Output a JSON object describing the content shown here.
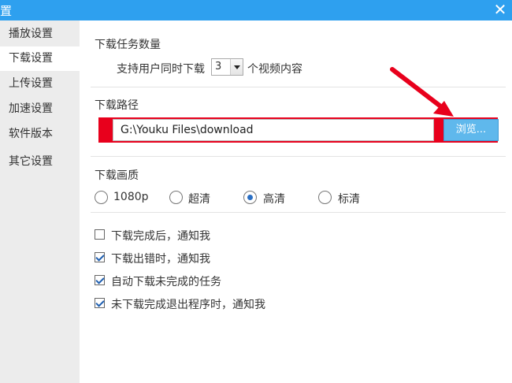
{
  "window": {
    "title": "置",
    "close_symbol": "✕"
  },
  "sidebar": {
    "items": [
      {
        "label": "播放设置",
        "active": false
      },
      {
        "label": "下载设置",
        "active": true
      },
      {
        "label": "上传设置",
        "active": false
      },
      {
        "label": "加速设置",
        "active": false
      },
      {
        "label": "软件版本",
        "active": false
      },
      {
        "label": "其它设置",
        "active": false
      }
    ]
  },
  "download_tasks": {
    "title": "下载任务数量",
    "prefix": "支持用户同时下载",
    "count": "3",
    "suffix": "个视频内容"
  },
  "download_path": {
    "title": "下载路径",
    "value": "G:\\Youku Files\\download",
    "browse_label": "浏览..."
  },
  "quality": {
    "title": "下载画质",
    "options": [
      {
        "label": "1080p",
        "checked": false
      },
      {
        "label": "超清",
        "checked": false
      },
      {
        "label": "高清",
        "checked": true
      },
      {
        "label": "标清",
        "checked": false
      }
    ]
  },
  "notifications": [
    {
      "label": "下载完成后，通知我",
      "checked": false
    },
    {
      "label": "下载出错时，通知我",
      "checked": true
    },
    {
      "label": "自动下载未完成的任务",
      "checked": true
    },
    {
      "label": "未下载完成退出程序时，通知我",
      "checked": true
    }
  ],
  "colors": {
    "titlebar": "#2ea0ef",
    "highlight": "#e8001c",
    "browse_button": "#5fb8ec",
    "arrow": "#e8001c"
  }
}
